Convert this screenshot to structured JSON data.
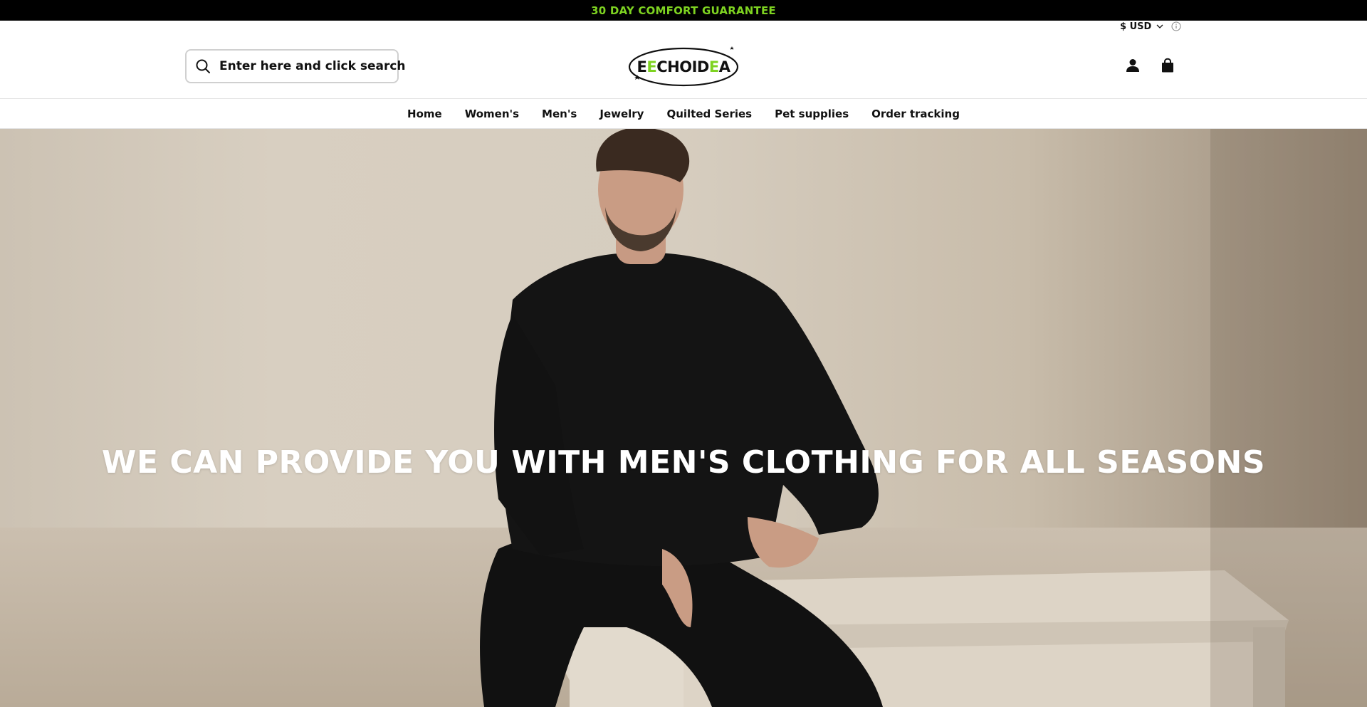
{
  "announcement": {
    "text": "30 DAY COMFORT GUARANTEE",
    "color": "#7ed321"
  },
  "header": {
    "currency": "$ USD",
    "currency_chevron_icon": "chevron-down-icon",
    "currency_info_icon": "info-icon",
    "search": {
      "placeholder": "Enter here and click search",
      "icon": "search-icon"
    },
    "logo": {
      "text_a": "E",
      "text_b": "E",
      "text_c": "CHOID",
      "text_d": "E",
      "text_e": "A"
    },
    "account_icon": "user-icon",
    "cart_icon": "shopping-bag-icon"
  },
  "nav": {
    "items": [
      {
        "label": "Home"
      },
      {
        "label": "Women's"
      },
      {
        "label": "Men's"
      },
      {
        "label": "Jewelry"
      },
      {
        "label": "Quilted Series"
      },
      {
        "label": "Pet supplies"
      },
      {
        "label": "Order tracking"
      }
    ]
  },
  "hero": {
    "heading": "WE CAN PROVIDE YOU WITH MEN'S CLOTHING FOR ALL SEASONS"
  },
  "colors": {
    "accent": "#7ed321",
    "announcement_bg": "#000000"
  }
}
